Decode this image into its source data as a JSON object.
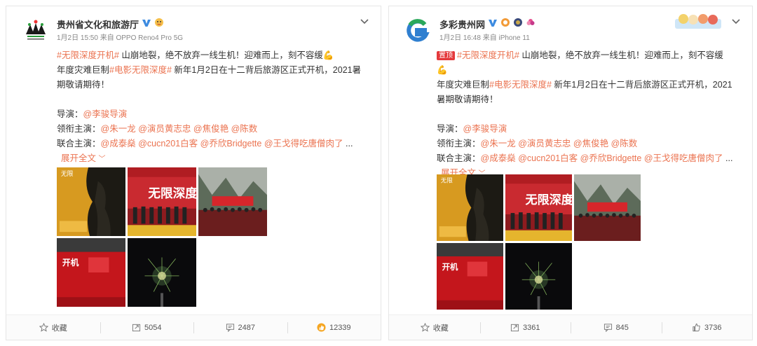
{
  "colors": {
    "accent": "#eb7350",
    "verified": "#3d8be0",
    "pinned": "#e4393c"
  },
  "posts": [
    {
      "nickname": "贵州省文化和旅游厅",
      "meta": "1月2日 15:50 来自 OPPO Reno4 Pro 5G",
      "pinned": "",
      "line1_tag": "#无限深度开机#",
      "line1_text": " 山崩地裂，绝不放弃一线生机！迎难而上，刻不容缓",
      "line2_text": "年度灾难巨制",
      "line2_tag": "#电影无限深度#",
      "line2_rest": " 新年1月2日在十二背后旅游区正式开机，2021暑期敬请期待！",
      "director_label": "导演：",
      "director": "@李骏导演",
      "cast_label": "领衔主演：",
      "cast": [
        "@朱一龙",
        "@演员黄志忠",
        "@焦俊艳",
        "@陈数"
      ],
      "costar_label": "联合主演：",
      "costar": [
        "@成泰燊",
        "@cucn201白客",
        "@乔欣Bridgette",
        "@王戈得吃唐僧肉了"
      ],
      "ellipsis": " ...",
      "expand": "展开全文",
      "expand_arrow": "﹀",
      "actions": {
        "collect": "收藏",
        "repost": "5054",
        "comment": "2487",
        "like": "12339"
      }
    },
    {
      "nickname": "多彩贵州网",
      "meta": "1月2日 16:48 来自 iPhone 11",
      "pinned": "置顶",
      "line1_tag": "#无限深度开机#",
      "line1_text": " 山崩地裂，绝不放弃一线生机！迎难而上，刻不容缓",
      "line2_text": "年度灾难巨制",
      "line2_tag": "#电影无限深度#",
      "line2_rest": " 新年1月2日在十二背后旅游区正式开机，2021暑期敬请期待！",
      "director_label": "导演：",
      "director": "@李骏导演",
      "cast_label": "领衔主演：",
      "cast": [
        "@朱一龙",
        "@演员黄志忠",
        "@焦俊艳",
        "@陈数"
      ],
      "costar_label": "联合主演：",
      "costar": [
        "@成泰燊",
        "@cucn201白客",
        "@乔欣Bridgette",
        "@王戈得吃唐僧肉了"
      ],
      "ellipsis": " ...",
      "expand": "展开全文",
      "expand_arrow": "﹀",
      "actions": {
        "collect": "收藏",
        "repost": "3361",
        "comment": "845",
        "like": "3736"
      }
    }
  ],
  "poster_text": {
    "title": "无限深度",
    "kaiji": "开机"
  }
}
